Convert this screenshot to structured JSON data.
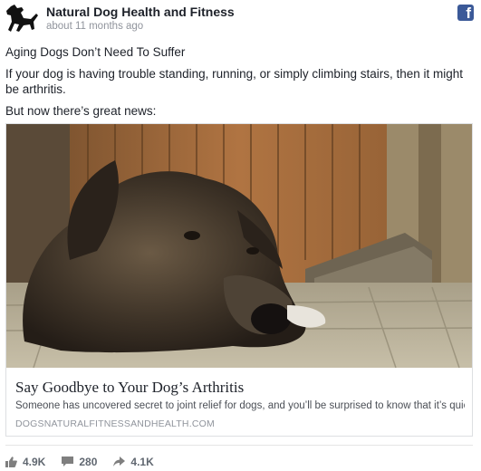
{
  "header": {
    "page_name": "Natural Dog Health and Fitness",
    "timestamp": "about 11 months ago",
    "brand_icon": "facebook-icon",
    "avatar_icon": "dog-silhouette-icon"
  },
  "post": {
    "paragraphs": [
      "Aging Dogs Don’t Need To Suffer",
      "If your dog is having trouble standing, running, or simply climbing stairs, then it might be arthritis.",
      "But now there’s great news:"
    ]
  },
  "link": {
    "image_subject": "dog-photo",
    "title": "Say Goodbye to Your Dog’s Arthritis",
    "description": "Someone has uncovered secret to joint relief for dogs, and you’ll be surprised to know that it’s quick...",
    "domain": "DOGSNATURALFITNESSANDHEALTH.COM"
  },
  "stats": {
    "likes": "4.9K",
    "comments": "280",
    "shares": "4.1K"
  },
  "colors": {
    "facebook_blue": "#3b5998",
    "muted_text": "#90949c",
    "stats_text": "#606770"
  }
}
